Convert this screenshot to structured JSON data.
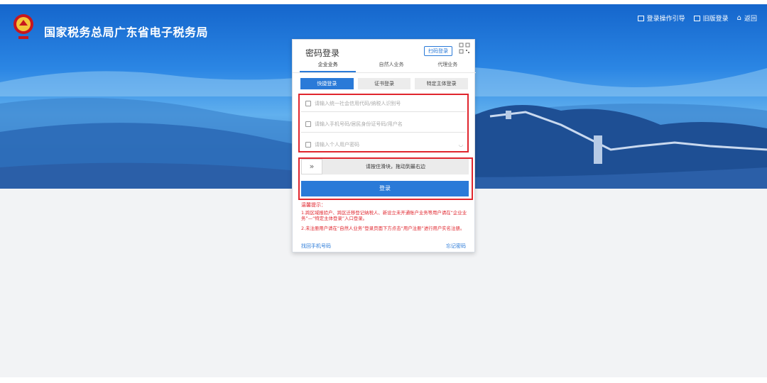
{
  "header": {
    "site_title": "国家税务总局广东省电子税务局",
    "links": [
      {
        "label": "登录操作引导",
        "icon": "guide-icon"
      },
      {
        "label": "旧版登录",
        "icon": "window-icon"
      },
      {
        "label": "返回",
        "icon": "home-icon"
      }
    ]
  },
  "login": {
    "title": "密码登录",
    "qr_login": "扫码登录",
    "user_tabs": [
      "企业业务",
      "自然人业务",
      "代理业务"
    ],
    "active_user_tab": 0,
    "modes": [
      "快捷登录",
      "证书登录",
      "特定主体登录"
    ],
    "active_mode": 0,
    "fields": [
      {
        "placeholder": "请输入统一社会信用代码/纳税人识别号",
        "icon": "id-card-icon"
      },
      {
        "placeholder": "请输入手机号码/居民身份证号码/用户名",
        "icon": "user-icon"
      },
      {
        "placeholder": "请输入个人用户密码",
        "icon": "lock-icon"
      }
    ],
    "slider_text": "请按住滑块，拖动到最右边",
    "login_button": "登录",
    "tips_title": "温馨提示：",
    "tip_1": "1.跨区域报验户、跨区迁移登记纳税人、新设立未开通账户业务等用户请在“企业业务”—“特定主体登录”入口登录。",
    "tip_2": "2.未注册用户请在“自然人业务”登录页面下方点击“用户注册”进行用户实名注册。",
    "link_left": "找回手机号码",
    "link_right": "忘记密码"
  },
  "colors": {
    "accent": "#2a7ad8",
    "warning": "#e0262e"
  }
}
